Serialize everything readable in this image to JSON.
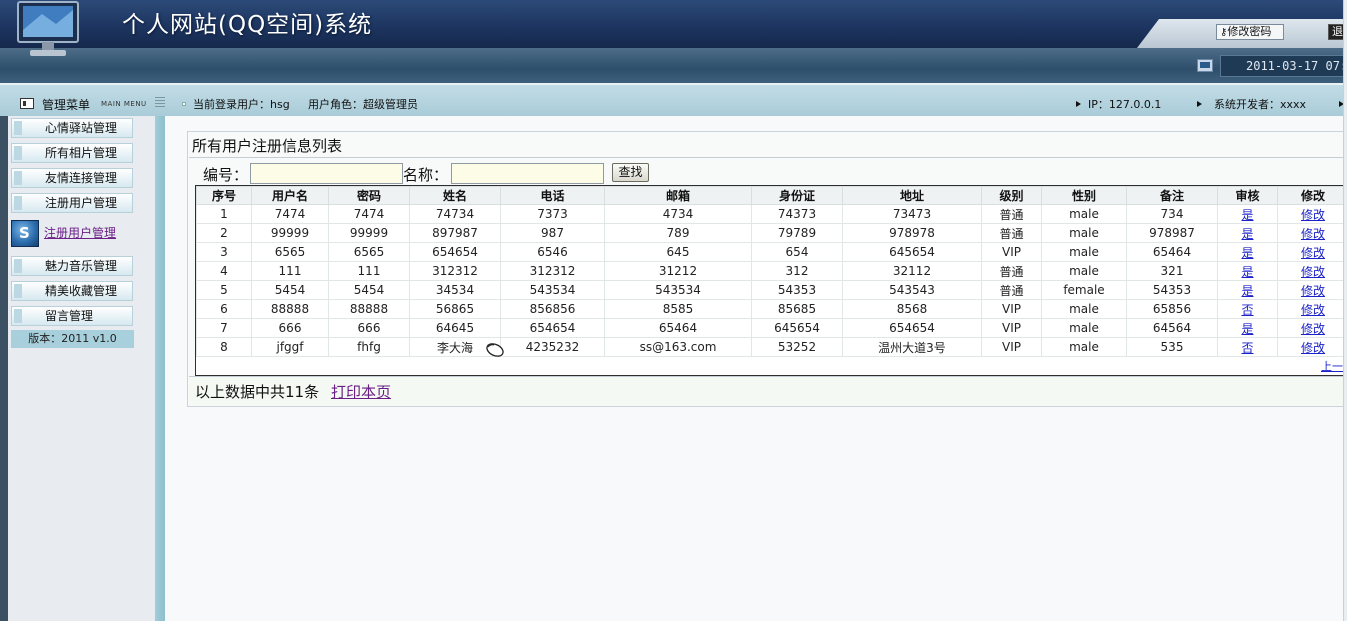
{
  "header": {
    "title": "个人网站(QQ空间)系统",
    "change_password": "修改密码",
    "exit_label": "退",
    "datetime": "2011-03-17 07:"
  },
  "infobar": {
    "menu_title": "管理菜单",
    "menu_title_en": "MAIN MENU",
    "current_user": "当前登录用户：hsg",
    "user_role": "用户角色：超级管理员",
    "ip": "IP：127.0.0.1",
    "developer": "系统开发者：xxxx"
  },
  "sidebar": {
    "items": [
      {
        "label": "心情驿站管理"
      },
      {
        "label": "所有相片管理"
      },
      {
        "label": "友情连接管理"
      },
      {
        "label": "注册用户管理"
      }
    ],
    "active_item": "注册用户管理",
    "items2": [
      {
        "label": "魅力音乐管理"
      },
      {
        "label": "精美收藏管理"
      },
      {
        "label": "留言管理"
      }
    ],
    "version": "版本：2011 v1.0"
  },
  "main": {
    "title": "所有用户注册信息列表",
    "search": {
      "id_label": "编号：",
      "id_value": "",
      "name_label": "名称：",
      "name_value": "",
      "button": "查找"
    },
    "columns": [
      "序号",
      "用户名",
      "密码",
      "姓名",
      "电话",
      "邮箱",
      "身份证",
      "地址",
      "级别",
      "性别",
      "备注",
      "审核",
      "修改"
    ],
    "rows": [
      [
        "1",
        "7474",
        "7474",
        "74734",
        "7373",
        "4734",
        "74373",
        "73473",
        "普通",
        "male",
        "734",
        "是",
        "修改"
      ],
      [
        "2",
        "99999",
        "99999",
        "897987",
        "987",
        "789",
        "79789",
        "978978",
        "普通",
        "male",
        "978987",
        "是",
        "修改"
      ],
      [
        "3",
        "6565",
        "6565",
        "654654",
        "6546",
        "645",
        "654",
        "645654",
        "VIP",
        "male",
        "65464",
        "是",
        "修改"
      ],
      [
        "4",
        "111",
        "111",
        "312312",
        "312312",
        "31212",
        "312",
        "32112",
        "普通",
        "male",
        "321",
        "是",
        "修改"
      ],
      [
        "5",
        "5454",
        "5454",
        "34534",
        "543534",
        "543534",
        "54353",
        "543543",
        "普通",
        "female",
        "54353",
        "是",
        "修改"
      ],
      [
        "6",
        "88888",
        "88888",
        "56865",
        "856856",
        "8585",
        "85685",
        "8568",
        "VIP",
        "male",
        "65856",
        "否",
        "修改"
      ],
      [
        "7",
        "666",
        "666",
        "64645",
        "654654",
        "65464",
        "645654",
        "654654",
        "VIP",
        "male",
        "64564",
        "是",
        "修改"
      ],
      [
        "8",
        "jfggf",
        "fhfg",
        "李大海",
        "4235232",
        "ss@163.com",
        "53252",
        "温州大道3号",
        "VIP",
        "male",
        "535",
        "否",
        "修改"
      ]
    ],
    "pager": "上一",
    "summary": "以上数据中共11条",
    "print_link": "打印本页"
  }
}
